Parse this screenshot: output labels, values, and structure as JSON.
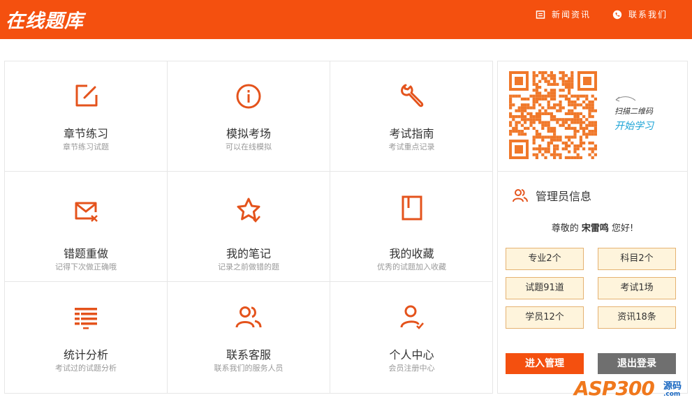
{
  "brand": {
    "logo_text": "在线题库",
    "accent": "#f4500f"
  },
  "header": {
    "news_label": "新闻资讯",
    "contact_label": "联系我们"
  },
  "tiles": [
    {
      "title": "章节练习",
      "subtitle": "章节练习试题",
      "icon": "edit-icon"
    },
    {
      "title": "模拟考场",
      "subtitle": "可以在线模拟",
      "icon": "info-icon"
    },
    {
      "title": "考试指南",
      "subtitle": "考试重点记录",
      "icon": "wrench-icon"
    },
    {
      "title": "错题重做",
      "subtitle": "记得下次做正确哦",
      "icon": "mail-error-icon"
    },
    {
      "title": "我的笔记",
      "subtitle": "记录之前做错的题",
      "icon": "star-check-icon"
    },
    {
      "title": "我的收藏",
      "subtitle": "优秀的试题加入收藏",
      "icon": "bookmark-book-icon"
    },
    {
      "title": "统计分析",
      "subtitle": "考试过的试题分析",
      "icon": "list-stats-icon"
    },
    {
      "title": "联系客服",
      "subtitle": "联系我们的服务人员",
      "icon": "users-icon"
    },
    {
      "title": "个人中心",
      "subtitle": "会员注册中心",
      "icon": "user-check-icon"
    }
  ],
  "qr": {
    "scan_text": "扫描二维码",
    "start_text": "开始学习"
  },
  "admin": {
    "heading": "管理员信息",
    "greeting_prefix": "尊敬的",
    "user_name": "宋雷鸣",
    "greeting_suffix": "您好!",
    "stats": [
      "专业2个",
      "科目2个",
      "试题91道",
      "考试1场",
      "学员12个",
      "资讯18条"
    ],
    "enter_label": "进入管理",
    "exit_label": "退出登录"
  },
  "watermark": {
    "main": "ASP300",
    "code": "源码",
    "domain": ".com"
  }
}
